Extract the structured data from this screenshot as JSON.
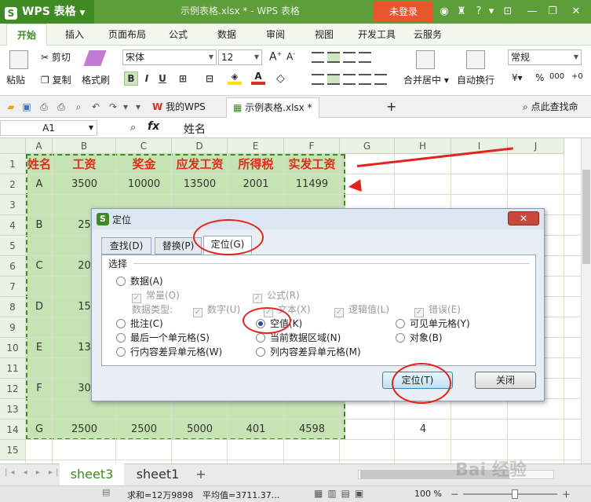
{
  "titlebar": {
    "app": "WPS 表格",
    "logo_letter": "S",
    "doc_title": "示例表格.xlsx * - WPS 表格",
    "login": "未登录"
  },
  "menu": [
    "开始",
    "插入",
    "页面布局",
    "公式",
    "数据",
    "审阅",
    "视图",
    "开发工具",
    "云服务"
  ],
  "ribbon": {
    "paste": "粘贴",
    "cut": "剪切",
    "copy": "复制",
    "format_painter": "格式刷",
    "font": "宋体",
    "size": "12",
    "bold": "B",
    "italic": "I",
    "underline": "U",
    "merge": "合并居中",
    "wrap": "自动换行",
    "numfmt": "常规",
    "percent": "%",
    "font_grow": "A",
    "font_shrink": "A",
    "text_color_letter": "A"
  },
  "doctabs": {
    "mywps": "我的WPS",
    "file": "示例表格.xlsx *",
    "search": "点此查找命令",
    "new": "+"
  },
  "formula": {
    "cellref": "A1",
    "fx": "fx",
    "content": "姓名"
  },
  "columns": [
    "A",
    "B",
    "C",
    "D",
    "E",
    "F",
    "G",
    "H",
    "I",
    "J"
  ],
  "rows": [
    "1",
    "2",
    "3",
    "4",
    "5",
    "6",
    "7",
    "8",
    "9",
    "10",
    "11",
    "12",
    "13",
    "14",
    "15"
  ],
  "cells": {
    "r1": [
      "姓名",
      "工资",
      "奖金",
      "应发工资",
      "所得税",
      "实发工资"
    ],
    "r2": [
      "A",
      "3500",
      "10000",
      "13500",
      "2001",
      "11499"
    ],
    "r4": [
      "B",
      "25"
    ],
    "r6": [
      "C",
      "20"
    ],
    "r8": [
      "D",
      "15"
    ],
    "r10": [
      "E",
      "13"
    ],
    "r12": [
      "F",
      "30"
    ],
    "r14": [
      "G",
      "2500",
      "2500",
      "5000",
      "401",
      "4598",
      "",
      "4"
    ]
  },
  "sheets": [
    "sheet3",
    "sheet1"
  ],
  "status": {
    "sum": "求和=12万9898",
    "avg": "平均值=3711.37...",
    "zoom": "100 %"
  },
  "dialog": {
    "title": "定位",
    "tabs": [
      "查找(D)",
      "替换(P)",
      "定位(G)"
    ],
    "section": "选择",
    "data": "数据(A)",
    "constant": "常量(O)",
    "formula": "公式(R)",
    "data_type": "数据类型:",
    "number": "数字(U)",
    "text": "文本(X)",
    "logical": "逻辑值(L)",
    "error": "错误(E)",
    "comment": "批注(C)",
    "blank": "空值(K)",
    "visible": "可见单元格(Y)",
    "last_cell": "最后一个单元格(S)",
    "current_region": "当前数据区域(N)",
    "object": "对象(B)",
    "row_diff": "行内容差异单元格(W)",
    "col_diff": "列内容差异单元格(M)",
    "goto": "定位(T)",
    "close": "关闭"
  },
  "watermark": "Bai 经验"
}
